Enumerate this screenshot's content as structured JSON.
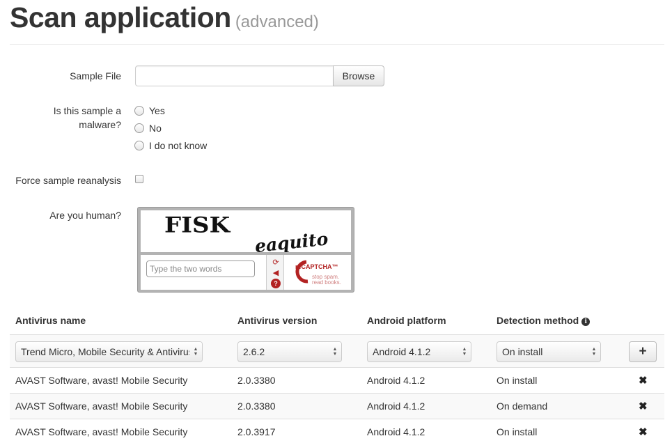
{
  "header": {
    "title": "Scan application",
    "subtitle": "(advanced)"
  },
  "form": {
    "sample_file_label": "Sample File",
    "sample_file_value": "",
    "browse_label": "Browse",
    "malware_question_line1": "Is this sample a",
    "malware_question_line2": "malware?",
    "malware_options": [
      "Yes",
      "No",
      "I do not know"
    ],
    "force_reanalysis_label": "Force sample reanalysis",
    "human_label": "Are you human?"
  },
  "captcha": {
    "word1": "FISK",
    "word2": "eaquito",
    "input_placeholder": "Type the two words",
    "logo_text": "reCAPTCHA™",
    "tagline_line1": "stop spam.",
    "tagline_line2": "read books.",
    "accent_color": "#b22222"
  },
  "table": {
    "headers": [
      "Antivirus name",
      "Antivirus version",
      "Android platform",
      "Detection method"
    ],
    "info_icon": "info-icon",
    "add_row": {
      "antivirus": "Trend Micro, Mobile Security & Antivirus",
      "version": "2.6.2",
      "platform": "Android 4.1.2",
      "method": "On install",
      "add_label": "+"
    },
    "rows": [
      {
        "antivirus": "AVAST Software, avast! Mobile Security",
        "version": "2.0.3380",
        "platform": "Android 4.1.2",
        "method": "On install",
        "remove": "✖"
      },
      {
        "antivirus": "AVAST Software, avast! Mobile Security",
        "version": "2.0.3380",
        "platform": "Android 4.1.2",
        "method": "On demand",
        "remove": "✖"
      },
      {
        "antivirus": "AVAST Software, avast! Mobile Security",
        "version": "2.0.3917",
        "platform": "Android 4.1.2",
        "method": "On install",
        "remove": "✖"
      }
    ]
  }
}
